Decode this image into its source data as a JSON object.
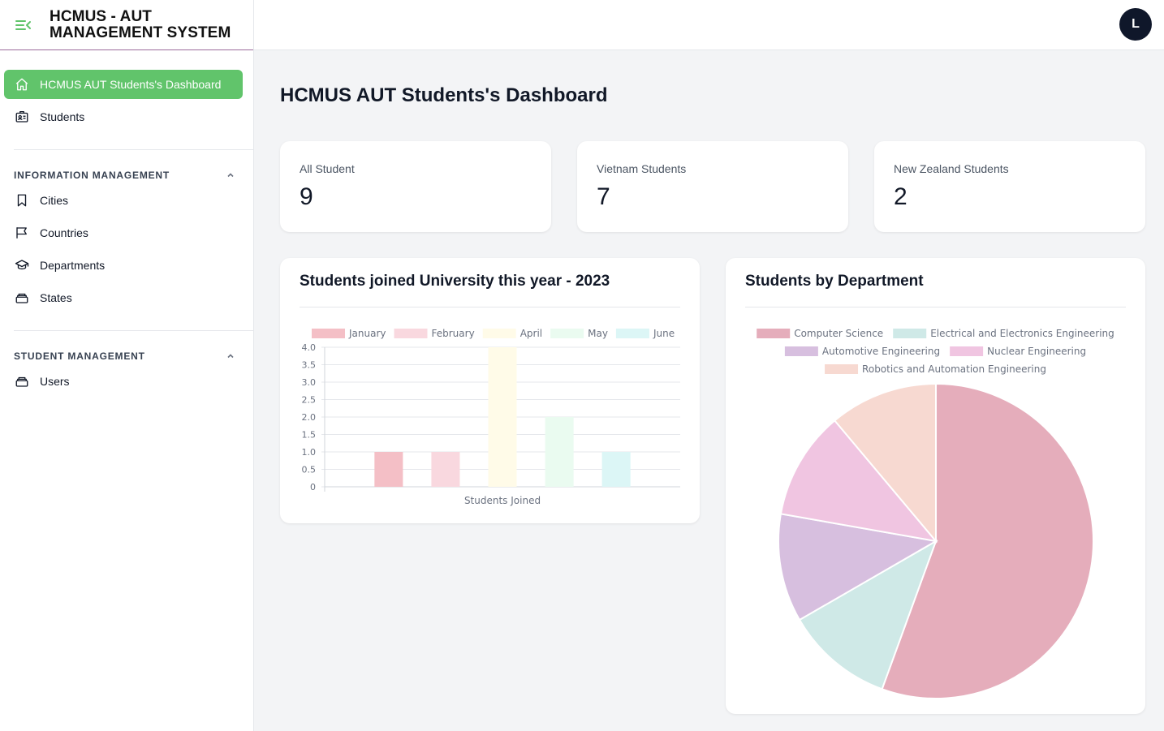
{
  "app": {
    "title": "HCMUS - AUT MANAGEMENT SYSTEM"
  },
  "topbar": {
    "avatar_initial": "L"
  },
  "sidebar": {
    "items": [
      {
        "label": "HCMUS AUT Students's Dashboard",
        "icon": "home-icon",
        "active": true
      },
      {
        "label": "Students",
        "icon": "id-card-icon",
        "active": false
      }
    ],
    "sections": [
      {
        "title": "INFORMATION MANAGEMENT",
        "items": [
          {
            "label": "Cities",
            "icon": "bookmark-icon"
          },
          {
            "label": "Countries",
            "icon": "flag-icon"
          },
          {
            "label": "Departments",
            "icon": "graduation-cap-icon"
          },
          {
            "label": "States",
            "icon": "stack-icon"
          }
        ]
      },
      {
        "title": "STUDENT MANAGEMENT",
        "items": [
          {
            "label": "Users",
            "icon": "stack-icon"
          }
        ]
      }
    ]
  },
  "main": {
    "title": "HCMUS AUT Students's Dashboard",
    "stats": [
      {
        "label": "All Student",
        "value": "9"
      },
      {
        "label": "Vietnam Students",
        "value": "7"
      },
      {
        "label": "New Zealand Students",
        "value": "2"
      }
    ]
  },
  "colors": {
    "accent": "#61c46b",
    "avatar": "#0f172a"
  },
  "chart_data": [
    {
      "type": "bar",
      "title": "Students joined University this year - 2023",
      "xlabel": "Students Joined",
      "ylabel": "",
      "ylim": [
        0,
        4
      ],
      "yticks": [
        "0",
        "0.5",
        "1.0",
        "1.5",
        "2.0",
        "2.5",
        "3.0",
        "3.5",
        "4.0"
      ],
      "legend": "top",
      "grid": true,
      "series": [
        {
          "name": "January",
          "value": 1,
          "color": "#f4bfc6"
        },
        {
          "name": "February",
          "value": 1,
          "color": "#f9d8df"
        },
        {
          "name": "April",
          "value": 4,
          "color": "#fffbe8"
        },
        {
          "name": "May",
          "value": 2,
          "color": "#eafbf0"
        },
        {
          "name": "June",
          "value": 1,
          "color": "#dcf6f6"
        }
      ]
    },
    {
      "type": "pie",
      "title": "Students by Department",
      "legend": "top",
      "slices": [
        {
          "label": "Computer Science",
          "value": 5,
          "color": "#e5adbb"
        },
        {
          "label": "Electrical and Electronics Engineering",
          "value": 1,
          "color": "#cfe9e7"
        },
        {
          "label": "Automotive Engineering",
          "value": 1,
          "color": "#d7bfdf"
        },
        {
          "label": "Nuclear Engineering",
          "value": 1,
          "color": "#f0c5e1"
        },
        {
          "label": "Robotics and Automation Engineering",
          "value": 1,
          "color": "#f7d9d1"
        }
      ]
    }
  ]
}
